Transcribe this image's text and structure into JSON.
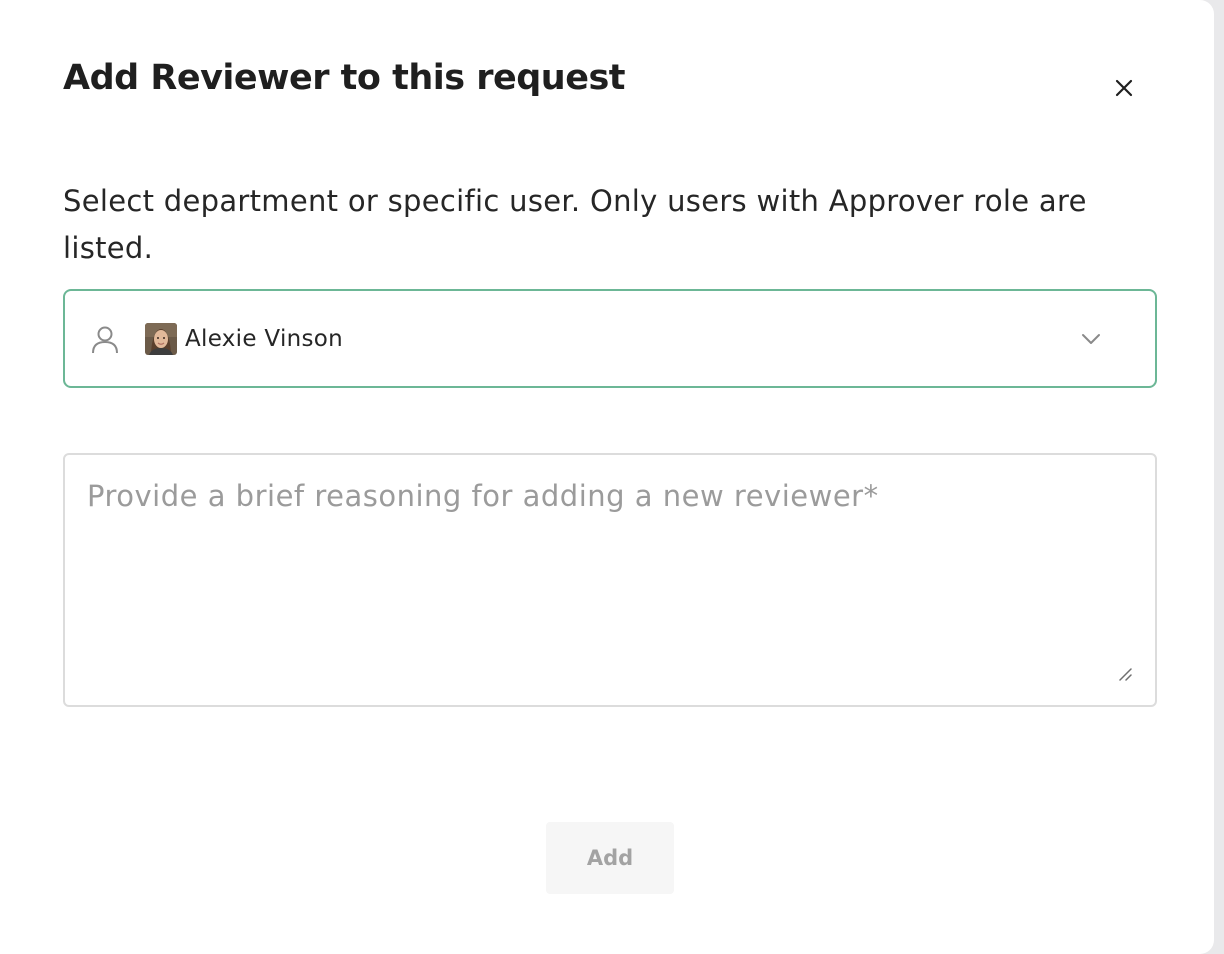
{
  "dialog": {
    "title": "Add Reviewer to this request",
    "description": "Select department or specific user. Only users with Approver role are listed.",
    "close_icon": "close-icon"
  },
  "reviewer_select": {
    "selected_value": "Alexie Vinson",
    "leading_icon": "user-icon",
    "trailing_icon": "chevron-down-icon",
    "border_color": "#6cb796"
  },
  "reasoning": {
    "placeholder": "Provide a brief reasoning for adding a new reviewer*",
    "value": ""
  },
  "actions": {
    "add_label": "Add"
  }
}
